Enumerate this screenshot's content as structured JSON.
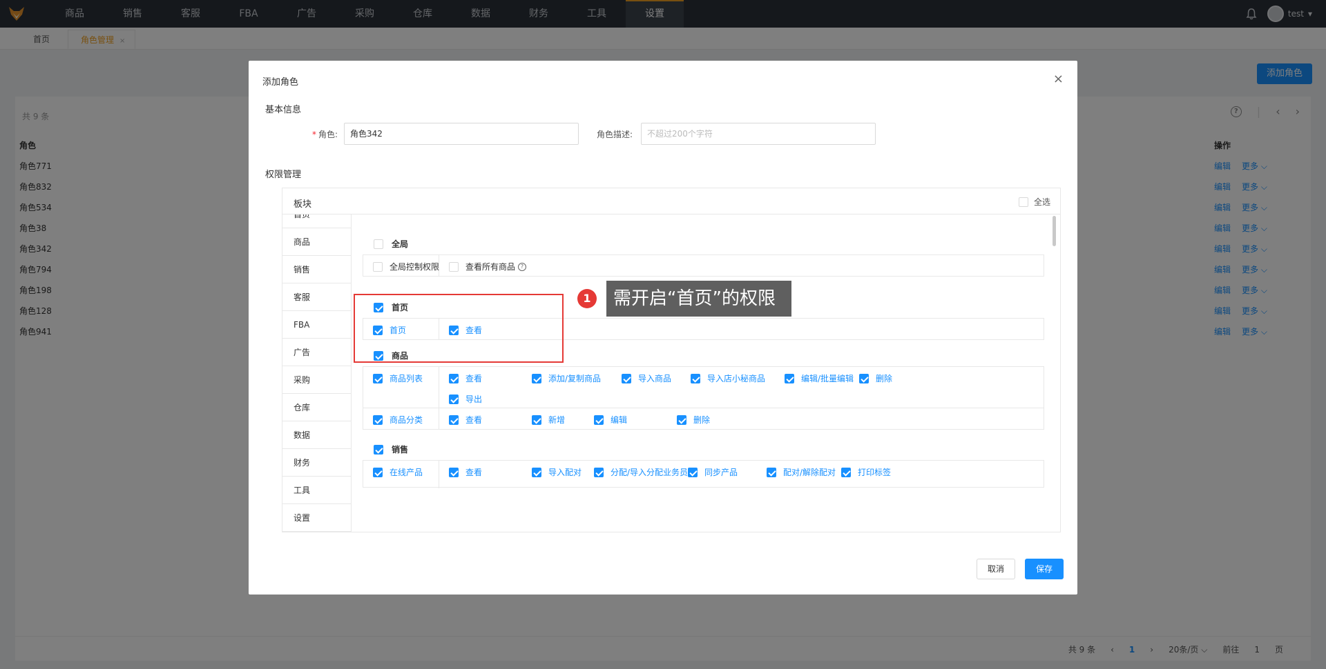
{
  "nav": {
    "items": [
      "商品",
      "销售",
      "客服",
      "FBA",
      "广告",
      "采购",
      "仓库",
      "数据",
      "财务",
      "工具",
      "设置"
    ],
    "active_index": 10,
    "user": "test",
    "logo_icon": "fox-logo-icon",
    "bell_icon": "bell-icon"
  },
  "tabs": {
    "home": "首页",
    "role_mgmt": "角色管理",
    "close": "×"
  },
  "page": {
    "add_role": "添加角色",
    "total": "共 9 条",
    "col_role": "角色",
    "col_op": "操作",
    "edit": "编辑",
    "more": "更多 ⌵",
    "rows": [
      "角色771",
      "角色832",
      "角色534",
      "角色38",
      "角色342",
      "角色794",
      "角色198",
      "角色128",
      "角色941"
    ],
    "pager": {
      "total": "共 9 条",
      "prev": "‹",
      "page": "1",
      "next": "›",
      "size": "20条/页 ⌵",
      "goto": "前往",
      "goto_val": "1",
      "unit": "页"
    }
  },
  "modal": {
    "title": "添加角色",
    "close": "×",
    "basic": "基本信息",
    "role_label": "角色:",
    "role_value": "角色342",
    "desc_label": "角色描述:",
    "desc_placeholder": "不超过200个字符",
    "perm": "权限管理",
    "block": "板块",
    "select_all": "全选",
    "side": [
      "首页",
      "商品",
      "销售",
      "客服",
      "FBA",
      "广告",
      "采购",
      "仓库",
      "数据",
      "财务",
      "工具",
      "设置"
    ],
    "g_global": "全局",
    "global_ctrl": "全局控制权限",
    "view_all_goods": "查看所有商品",
    "g_home": "首页",
    "home_row": "首页",
    "view": "查看",
    "g_goods": "商品",
    "goods_list": "商品列表",
    "goods_list_items": [
      "查看",
      "添加/复制商品",
      "导入商品",
      "导入店小秘商品",
      "编辑/批量编辑",
      "删除",
      "导出"
    ],
    "goods_cat": "商品分类",
    "goods_cat_items": [
      "查看",
      "新增",
      "编辑",
      "删除"
    ],
    "g_sales": "销售",
    "online": "在线产品",
    "online_items": [
      "查看",
      "导入配对",
      "分配/导入分配业务员",
      "同步产品",
      "配对/解除配对",
      "打印标签"
    ],
    "cancel": "取消",
    "save": "保存"
  },
  "annotation": {
    "num": "1",
    "text": "需开启“首页”的权限"
  },
  "colors": {
    "accent": "#1890ff",
    "nav_bg": "#2b3138",
    "active_tab": "#f0a020",
    "annotation": "#e53935"
  }
}
